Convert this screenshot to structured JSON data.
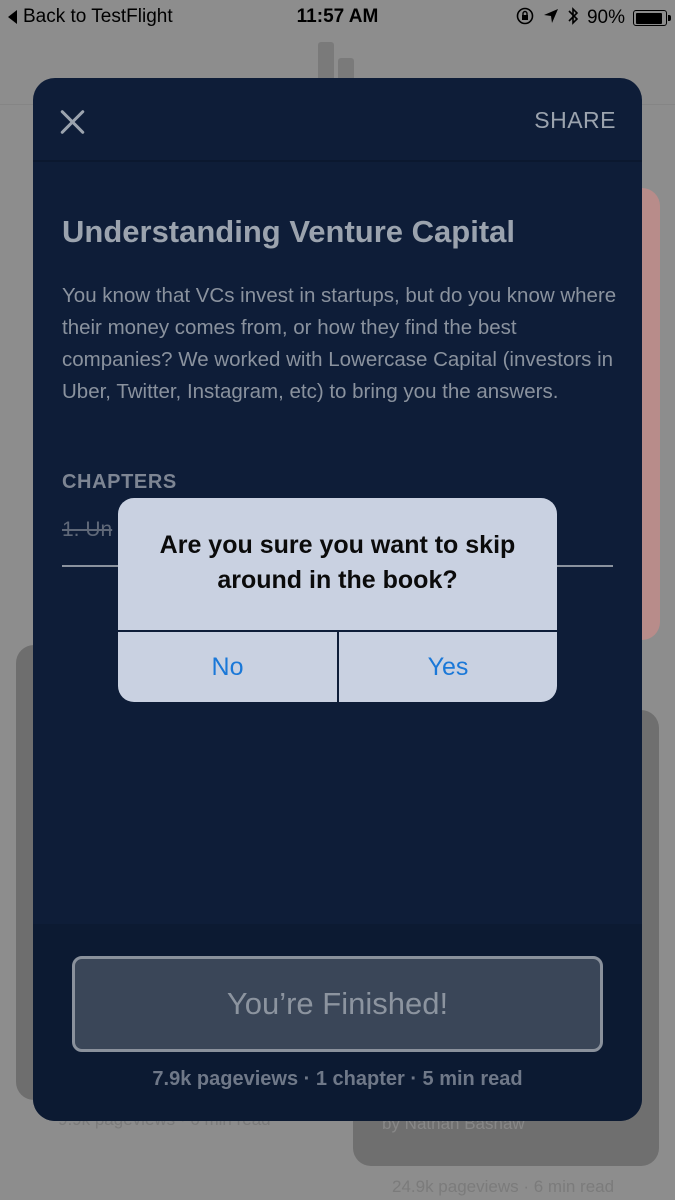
{
  "status_bar": {
    "back_label": "Back to TestFlight",
    "time": "11:57 AM",
    "battery_text": "90%",
    "battery_level": 0.9,
    "icons": [
      "rotation-lock-icon",
      "location-arrow-icon",
      "bluetooth-icon",
      "battery-icon"
    ]
  },
  "background": {
    "left_card_stats": "9.9k pageviews · 6 min read",
    "right_card_author": "by Nathan Bashaw",
    "right_card_stats": "24.9k pageviews · 6 min read"
  },
  "sheet": {
    "share_label": "SHARE",
    "title": "Understanding Venture Capital",
    "description": "You know that VCs invest in startups, but do you know where their money comes from, or how they find the best companies? We worked with Lowercase Capital (investors in Uber, Twitter, Instagram, etc) to bring you the answers.",
    "chapters_heading": "CHAPTERS",
    "chapter_1": "1. Un",
    "finish_label": "You’re Finished!",
    "stats": "7.9k pageviews · 1 chapter · 5 min read"
  },
  "alert": {
    "message": "Are you sure you want to skip around in the book?",
    "no_label": "No",
    "yes_label": "Yes"
  },
  "colors": {
    "sheet_bg": "#0e1d38",
    "alert_bg": "#c9d1e1",
    "alert_button": "#1a78d8"
  }
}
